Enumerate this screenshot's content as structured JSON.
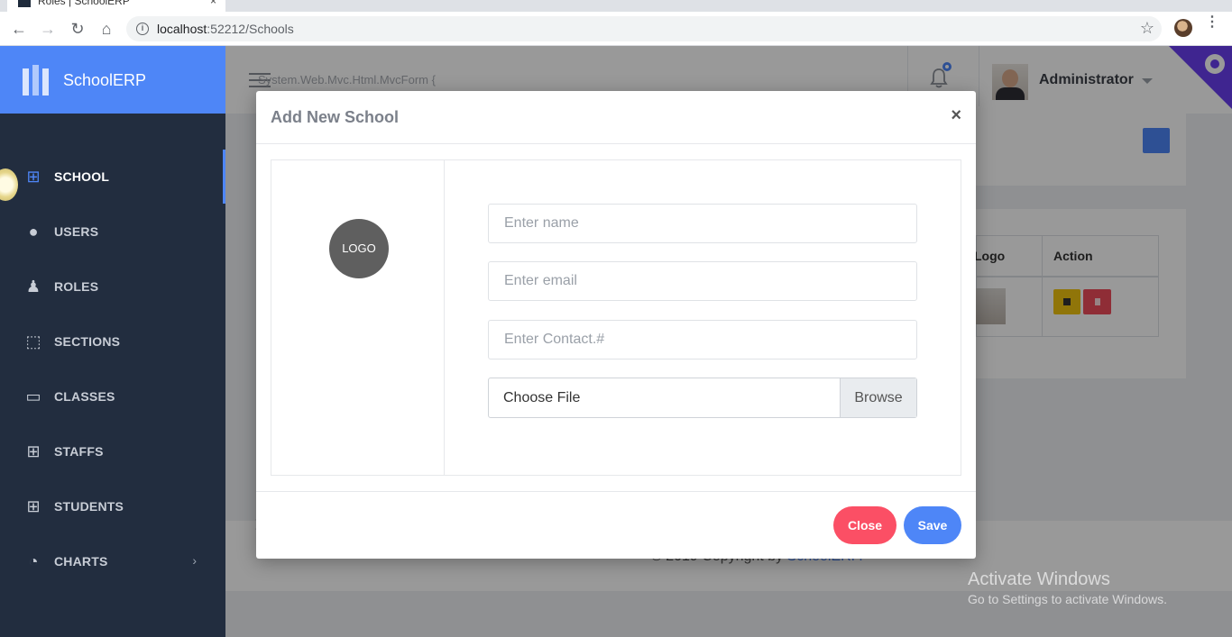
{
  "browser": {
    "tab_title": "Roles | SchoolERP",
    "tab_close": "×",
    "url_host": "localhost",
    "url_rest": ":52212/Schools",
    "back": "←",
    "forward": "→",
    "reload": "↻",
    "home": "⌂",
    "info": "i",
    "star": "☆",
    "menu": "⋮"
  },
  "brand": {
    "name": "SchoolERP",
    "color": "#4e86f7"
  },
  "sidebar": {
    "items": [
      {
        "label": "SCHOOL",
        "icon": "⊞",
        "active": true
      },
      {
        "label": "USERS",
        "icon": "●"
      },
      {
        "label": "ROLES",
        "icon": "♟"
      },
      {
        "label": "SECTIONS",
        "icon": "⬚"
      },
      {
        "label": "CLASSES",
        "icon": "▭"
      },
      {
        "label": "STAFFS",
        "icon": "⊞"
      },
      {
        "label": "STUDENTS",
        "icon": "⊞"
      },
      {
        "label": "CHARTS",
        "icon": "◔",
        "chevron": "›"
      }
    ]
  },
  "topbar": {
    "mvc_text": "System.Web.Mvc.Html.MvcForm {",
    "admin_name": "Administrator"
  },
  "content": {
    "table_headers": [
      "Logo",
      "Action"
    ]
  },
  "footer": {
    "text": "© 2019 Copyright by ",
    "brand": "SchoolERP.",
    "brace": "}"
  },
  "watermark": {
    "title": "Activate Windows",
    "subtitle": "Go to Settings to activate Windows."
  },
  "modal": {
    "title": "Add New School",
    "close_glyph": "×",
    "logo_text": "LOGO",
    "name_placeholder": "Enter name",
    "email_placeholder": "Enter email",
    "contact_placeholder": "Enter Contact.#",
    "file_label": "Choose File",
    "browse_label": "Browse",
    "close_button": "Close",
    "save_button": "Save"
  }
}
